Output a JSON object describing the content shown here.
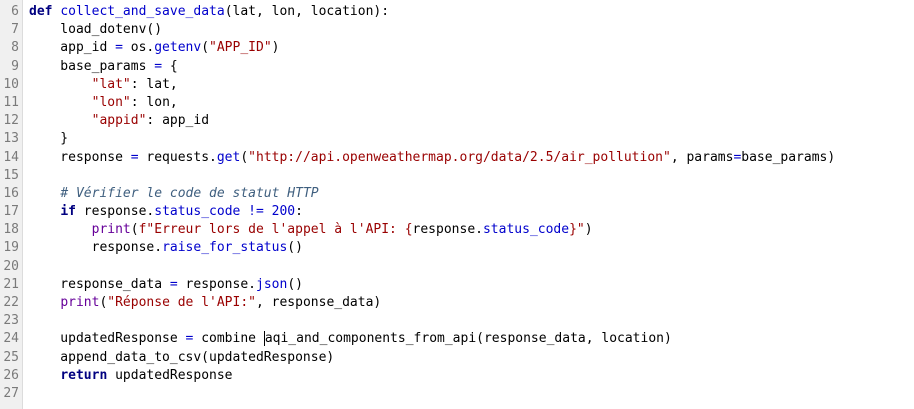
{
  "editor": {
    "lines": [
      {
        "num": "6",
        "tokens": [
          {
            "t": "def",
            "c": "kw"
          },
          {
            "t": " ",
            "c": ""
          },
          {
            "t": "collect_and_save_data",
            "c": "fn"
          },
          {
            "t": "(lat, lon, location):",
            "c": ""
          }
        ]
      },
      {
        "num": "7",
        "tokens": [
          {
            "t": "    load_dotenv()",
            "c": ""
          }
        ]
      },
      {
        "num": "8",
        "tokens": [
          {
            "t": "    app_id ",
            "c": ""
          },
          {
            "t": "=",
            "c": "op"
          },
          {
            "t": " os.",
            "c": ""
          },
          {
            "t": "getenv",
            "c": "attr"
          },
          {
            "t": "(",
            "c": ""
          },
          {
            "t": "\"APP_ID\"",
            "c": "str"
          },
          {
            "t": ")",
            "c": ""
          }
        ]
      },
      {
        "num": "9",
        "tokens": [
          {
            "t": "    base_params ",
            "c": ""
          },
          {
            "t": "=",
            "c": "op"
          },
          {
            "t": " {",
            "c": ""
          }
        ]
      },
      {
        "num": "10",
        "tokens": [
          {
            "t": "        ",
            "c": ""
          },
          {
            "t": "\"lat\"",
            "c": "str"
          },
          {
            "t": ": lat,",
            "c": ""
          }
        ]
      },
      {
        "num": "11",
        "tokens": [
          {
            "t": "        ",
            "c": ""
          },
          {
            "t": "\"lon\"",
            "c": "str"
          },
          {
            "t": ": lon,",
            "c": ""
          }
        ]
      },
      {
        "num": "12",
        "tokens": [
          {
            "t": "        ",
            "c": ""
          },
          {
            "t": "\"appid\"",
            "c": "str"
          },
          {
            "t": ": app_id",
            "c": ""
          }
        ]
      },
      {
        "num": "13",
        "tokens": [
          {
            "t": "    }",
            "c": ""
          }
        ]
      },
      {
        "num": "14",
        "tokens": [
          {
            "t": "    response ",
            "c": ""
          },
          {
            "t": "=",
            "c": "op"
          },
          {
            "t": " requests.",
            "c": ""
          },
          {
            "t": "get",
            "c": "attr"
          },
          {
            "t": "(",
            "c": ""
          },
          {
            "t": "\"http://api.openweathermap.org/data/2.5/air_pollution\"",
            "c": "str"
          },
          {
            "t": ", params",
            "c": ""
          },
          {
            "t": "=",
            "c": "op"
          },
          {
            "t": "base_params)",
            "c": ""
          }
        ]
      },
      {
        "num": "15",
        "tokens": []
      },
      {
        "num": "16",
        "tokens": [
          {
            "t": "    ",
            "c": ""
          },
          {
            "t": "# Vérifier le code de statut HTTP",
            "c": "cm"
          }
        ]
      },
      {
        "num": "17",
        "tokens": [
          {
            "t": "    ",
            "c": ""
          },
          {
            "t": "if",
            "c": "kw"
          },
          {
            "t": " response.",
            "c": ""
          },
          {
            "t": "status_code",
            "c": "attr"
          },
          {
            "t": " ",
            "c": ""
          },
          {
            "t": "!=",
            "c": "op"
          },
          {
            "t": " ",
            "c": ""
          },
          {
            "t": "200",
            "c": "num"
          },
          {
            "t": ":",
            "c": ""
          }
        ]
      },
      {
        "num": "18",
        "tokens": [
          {
            "t": "        ",
            "c": ""
          },
          {
            "t": "print",
            "c": "bi"
          },
          {
            "t": "(",
            "c": ""
          },
          {
            "t": "f\"Erreur lors de l'appel à l'API: {",
            "c": "str"
          },
          {
            "t": "response.",
            "c": ""
          },
          {
            "t": "status_code",
            "c": "attr"
          },
          {
            "t": "}\"",
            "c": "str"
          },
          {
            "t": ")",
            "c": ""
          }
        ]
      },
      {
        "num": "19",
        "tokens": [
          {
            "t": "        response.",
            "c": ""
          },
          {
            "t": "raise_for_status",
            "c": "attr"
          },
          {
            "t": "()",
            "c": ""
          }
        ]
      },
      {
        "num": "20",
        "tokens": []
      },
      {
        "num": "21",
        "tokens": [
          {
            "t": "    response_data ",
            "c": ""
          },
          {
            "t": "=",
            "c": "op"
          },
          {
            "t": " response.",
            "c": ""
          },
          {
            "t": "json",
            "c": "attr"
          },
          {
            "t": "()",
            "c": ""
          }
        ]
      },
      {
        "num": "22",
        "tokens": [
          {
            "t": "    ",
            "c": ""
          },
          {
            "t": "print",
            "c": "bi"
          },
          {
            "t": "(",
            "c": ""
          },
          {
            "t": "\"Réponse de l'API:\"",
            "c": "str"
          },
          {
            "t": ", response_data)",
            "c": ""
          }
        ]
      },
      {
        "num": "23",
        "tokens": []
      },
      {
        "num": "24",
        "tokens": [
          {
            "t": "    updatedResponse ",
            "c": ""
          },
          {
            "t": "=",
            "c": "op"
          },
          {
            "t": " combine ",
            "c": ""
          },
          {
            "t": "",
            "c": "cursor"
          },
          {
            "t": "aqi_and_components_from_api(response_data, location)",
            "c": ""
          }
        ]
      },
      {
        "num": "25",
        "tokens": [
          {
            "t": "    append_data_to_csv(updatedResponse)",
            "c": ""
          }
        ]
      },
      {
        "num": "26",
        "tokens": [
          {
            "t": "    ",
            "c": ""
          },
          {
            "t": "return",
            "c": "kw"
          },
          {
            "t": " updatedResponse",
            "c": ""
          }
        ]
      },
      {
        "num": "27",
        "tokens": []
      }
    ]
  }
}
